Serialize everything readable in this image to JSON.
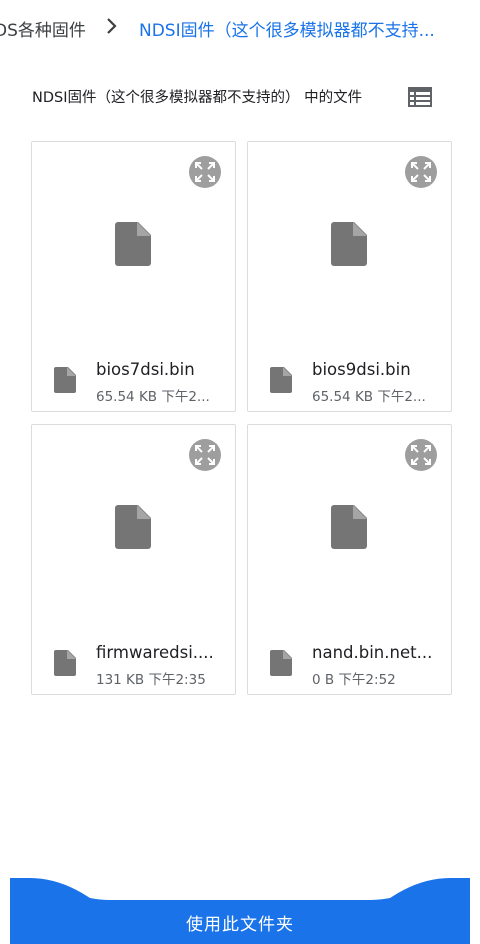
{
  "breadcrumb": {
    "previous": "DS各种固件",
    "current": "NDSI固件（这个很多模拟器都不支持..."
  },
  "header": {
    "title": "NDSI固件（这个很多模拟器都不支持的） 中的文件"
  },
  "files": [
    {
      "name": "bios7dsi.bin",
      "meta": "65.54 KB 下午2..."
    },
    {
      "name": "bios9dsi.bin",
      "meta": "65.54 KB 下午2..."
    },
    {
      "name": "firmwaredsi....",
      "meta": "131 KB 下午2:35"
    },
    {
      "name": "nand.bin.net...",
      "meta": "0 B 下午2:52"
    }
  ],
  "action": {
    "use_folder_label": "使用此文件夹"
  },
  "colors": {
    "accent": "#1a73e8",
    "icon_gray": "#757575"
  }
}
